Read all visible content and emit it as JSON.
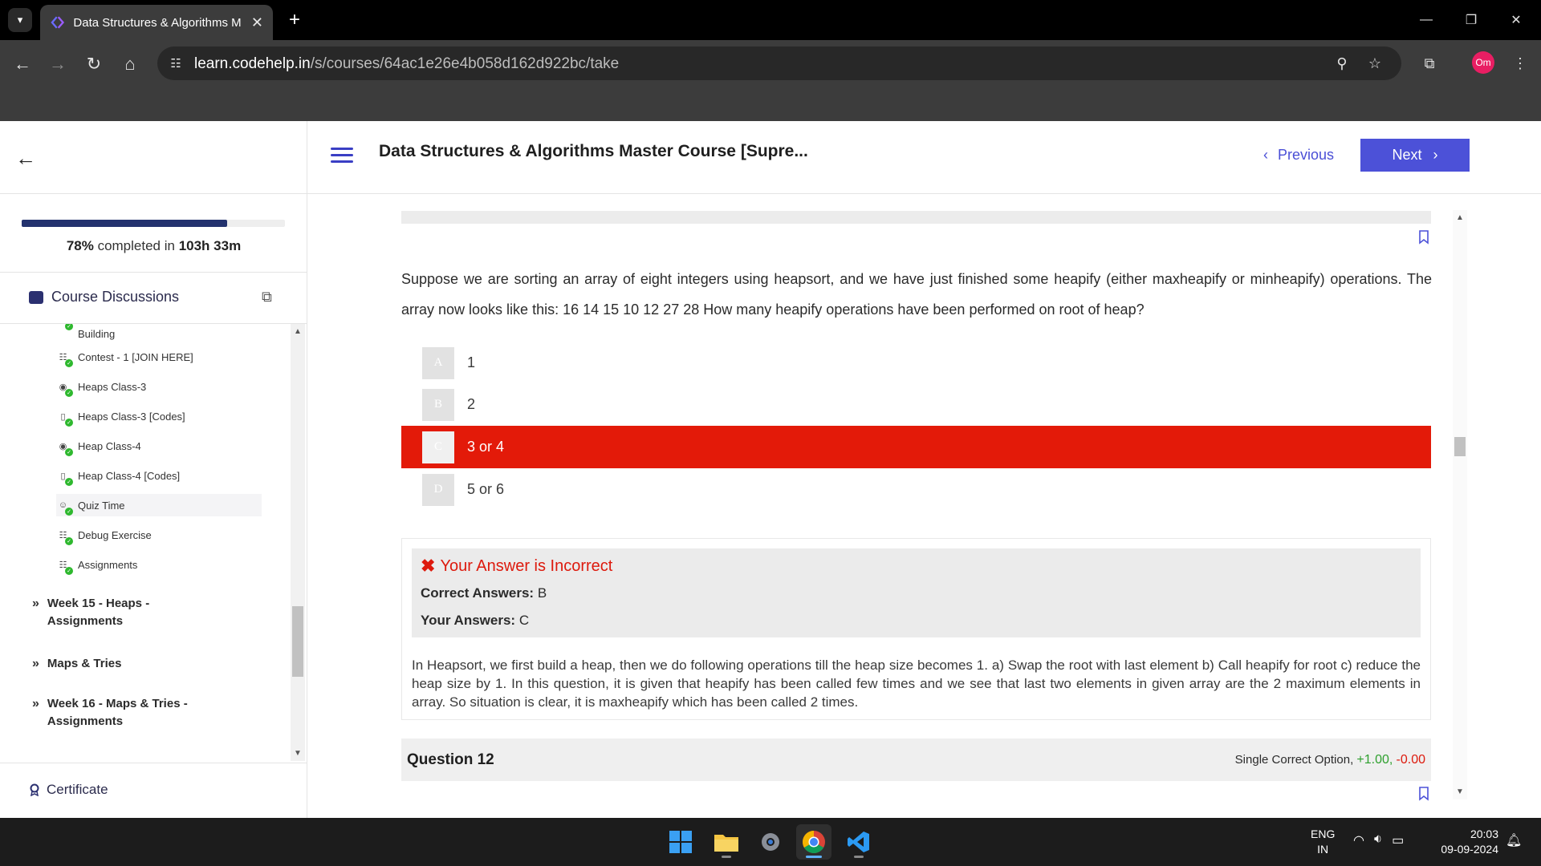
{
  "browser": {
    "tab_title": "Data Structures & Algorithms M",
    "url_host": "learn.codehelp.in",
    "url_path": "/s/courses/64ac1e26e4b058d162d922bc/take",
    "profile_initials": "Om"
  },
  "header": {
    "course_title": "Data Structures & Algorithms Master Course [Supre...",
    "previous_label": "Previous",
    "next_label": "Next"
  },
  "sidebar": {
    "progress_fraction": 0.78,
    "progress_percent": "78%",
    "progress_mid": " completed in ",
    "progress_time": "103h 33m",
    "discussions_label": "Course Discussions",
    "lessons": [
      {
        "label": "Building",
        "icon": "doc-icon"
      },
      {
        "label": "Contest - 1 [JOIN HERE]",
        "icon": "list-icon"
      },
      {
        "label": "Heaps Class-3",
        "icon": "live-icon"
      },
      {
        "label": "Heaps Class-3 [Codes]",
        "icon": "file-icon"
      },
      {
        "label": "Heap Class-4",
        "icon": "live-icon"
      },
      {
        "label": "Heap Class-4 [Codes]",
        "icon": "file-icon"
      },
      {
        "label": "Quiz Time",
        "icon": "quiz-icon"
      },
      {
        "label": "Debug Exercise",
        "icon": "list-icon"
      },
      {
        "label": "Assignments",
        "icon": "list-icon"
      }
    ],
    "weeks": [
      {
        "line1": "Week 15 - Heaps -",
        "line2": "Assignments"
      },
      {
        "line1": "Maps & Tries",
        "line2": ""
      },
      {
        "line1": "Week 16 - Maps & Tries -",
        "line2": "Assignments"
      }
    ],
    "certificate_label": "Certificate"
  },
  "question": {
    "text": "Suppose we are sorting an array of eight integers using heapsort, and we have just finished some heapify (either maxheapify or minheapify) operations. The array now looks like this: 16 14 15 10 12 27 28 How many heapify operations have been performed on root of heap?",
    "options": [
      {
        "letter": "A",
        "text": "1"
      },
      {
        "letter": "B",
        "text": "2"
      },
      {
        "letter": "C",
        "text": "3 or 4"
      },
      {
        "letter": "D",
        "text": "5 or 6"
      }
    ],
    "selected": "C"
  },
  "result": {
    "title": "Your Answer is Incorrect",
    "correct_label": "Correct Answers:",
    "correct_value": "B",
    "your_label": "Your Answers:",
    "your_value": "C",
    "explanation": "In Heapsort, we first build a heap, then we do following operations till the heap size becomes 1. a) Swap the root with last element b) Call heapify for root c) reduce the heap size by 1. In this question, it is given that heapify has been called few times and we see that last two elements in given array are the 2 maximum elements in array. So situation is clear, it is maxheapify which has been called 2 times."
  },
  "next_question": {
    "title": "Question 12",
    "type_label": "Single Correct Option,",
    "positive": "+1.00,",
    "negative": "-0.00"
  },
  "taskbar": {
    "lang_line1": "ENG",
    "lang_line2": "IN",
    "time": "20:03",
    "date": "09-09-2024"
  },
  "colors": {
    "accent": "#4c51d8",
    "wrong": "#e31a09",
    "progress": "#23326e",
    "positive": "#2ea02e"
  }
}
